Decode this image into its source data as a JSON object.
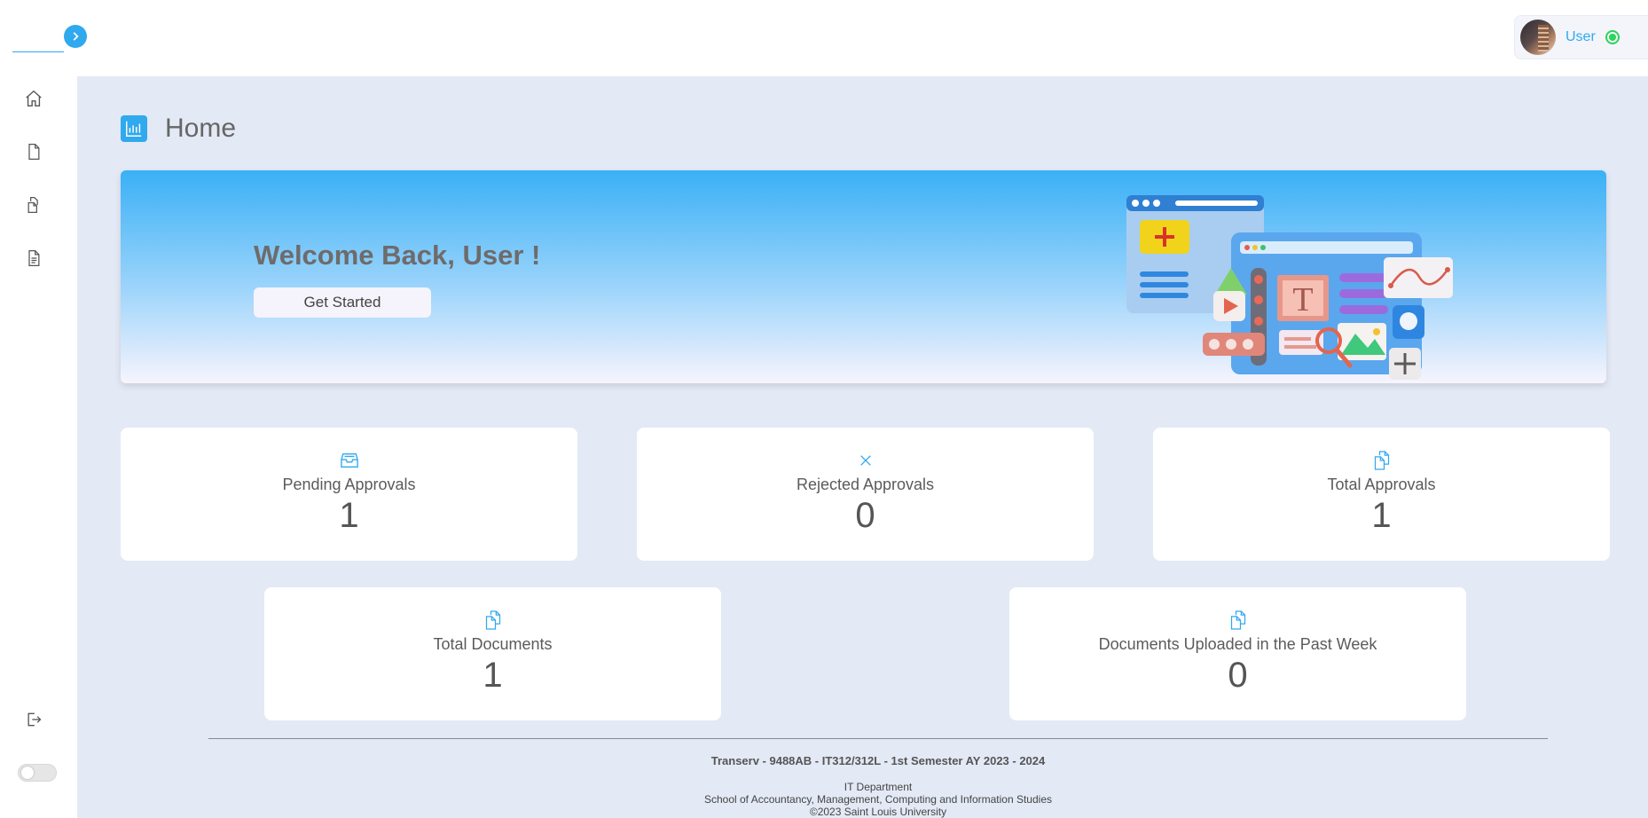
{
  "header": {
    "user_name": "User"
  },
  "sidebar": {
    "items": [
      {
        "icon": "home-icon"
      },
      {
        "icon": "document-icon"
      },
      {
        "icon": "approvals-icon"
      },
      {
        "icon": "report-icon"
      }
    ],
    "logout_icon": "logout-icon"
  },
  "page": {
    "title": "Home"
  },
  "banner": {
    "welcome": "Welcome Back, User !",
    "button_label": "Get Started"
  },
  "stats": [
    {
      "label": "Pending Approvals",
      "value": "1",
      "icon": "inbox-icon"
    },
    {
      "label": "Rejected Approvals",
      "value": "0",
      "icon": "close-icon"
    },
    {
      "label": "Total Approvals",
      "value": "1",
      "icon": "files-icon"
    },
    {
      "label": "Total Documents",
      "value": "1",
      "icon": "files-icon"
    },
    {
      "label": "Documents Uploaded in the Past Week",
      "value": "0",
      "icon": "files-icon"
    }
  ],
  "footer": {
    "main": "Transerv - 9488AB - IT312/312L - 1st Semester AY 2023 - 2024",
    "department": "IT Department",
    "school": "School of Accountancy, Management, Computing and Information Studies",
    "copyright": "©2023 Saint Louis University"
  },
  "colors": {
    "accent": "#30a9ee",
    "background": "#e3e9f5",
    "online": "#2bd45a"
  }
}
